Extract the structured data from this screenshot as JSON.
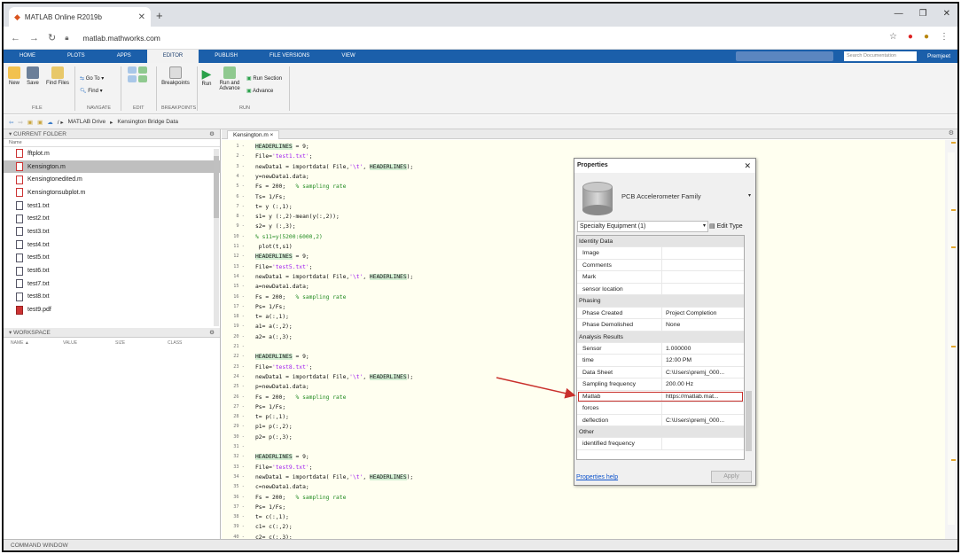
{
  "browser": {
    "tab_title": "MATLAB Online R2019b",
    "url": "matlab.mathworks.com"
  },
  "toolstrip": {
    "tabs": [
      "HOME",
      "PLOTS",
      "APPS",
      "EDITOR",
      "PUBLISH",
      "FILE VERSIONS",
      "VIEW"
    ],
    "active_tab": "EDITOR",
    "search_placeholder": "Search Documentation",
    "user": "Premjeet"
  },
  "ribbon": {
    "new": "New",
    "save": "Save",
    "find_files": "Find Files",
    "go_to": "Go To",
    "find": "Find",
    "breakpoints": "Breakpoints",
    "run": "Run",
    "run_and_advance": "Run and Advance",
    "run_section": "Run Section",
    "advance": "Advance",
    "groups": [
      "FILE",
      "NAVIGATE",
      "EDIT",
      "BREAKPOINTS",
      "RUN"
    ]
  },
  "pathbar": {
    "crumbs": [
      "MATLAB Drive",
      "Kensington Bridge Data"
    ]
  },
  "current_folder": {
    "title": "CURRENT FOLDER",
    "col_name": "Name",
    "files": [
      {
        "name": "fftplot.m",
        "type": "m",
        "selected": false
      },
      {
        "name": "Kensington.m",
        "type": "m",
        "selected": true
      },
      {
        "name": "Kensingtonedited.m",
        "type": "m",
        "selected": false
      },
      {
        "name": "Kensingtonsubplot.m",
        "type": "m",
        "selected": false
      },
      {
        "name": "test1.txt",
        "type": "txt",
        "selected": false
      },
      {
        "name": "test2.txt",
        "type": "txt",
        "selected": false
      },
      {
        "name": "test3.txt",
        "type": "txt",
        "selected": false
      },
      {
        "name": "test4.txt",
        "type": "txt",
        "selected": false
      },
      {
        "name": "test5.txt",
        "type": "txt",
        "selected": false
      },
      {
        "name": "test6.txt",
        "type": "txt",
        "selected": false
      },
      {
        "name": "test7.txt",
        "type": "txt",
        "selected": false
      },
      {
        "name": "test8.txt",
        "type": "txt",
        "selected": false
      },
      {
        "name": "test9.pdf",
        "type": "pdf",
        "selected": false
      }
    ]
  },
  "workspace": {
    "title": "WORKSPACE",
    "columns": [
      "NAME ▲",
      "VALUE",
      "SIZE",
      "CLASS"
    ]
  },
  "editor": {
    "tab": "Kensington.m ×",
    "lines": [
      [
        {
          "t": "HEADERLINES",
          "c": "hl"
        },
        {
          "t": " = 9;"
        }
      ],
      [
        {
          "t": "File="
        },
        {
          "t": "'test1.txt'",
          "c": "str"
        },
        {
          "t": ";"
        }
      ],
      [
        {
          "t": "newData1 = importdata( File,"
        },
        {
          "t": "'\\t'",
          "c": "str"
        },
        {
          "t": ", "
        },
        {
          "t": "HEADERLINES",
          "c": "hl"
        },
        {
          "t": ");"
        }
      ],
      [
        {
          "t": "y=newData1.data;"
        }
      ],
      [
        {
          "t": "Fs = 200;   "
        },
        {
          "t": "% sampling rate",
          "c": "cmt"
        }
      ],
      [
        {
          "t": "Ts= 1/Fs;"
        }
      ],
      [
        {
          "t": "t= y (:,1);"
        }
      ],
      [
        {
          "t": "s1= y (:,2)-mean(y(:,2));"
        }
      ],
      [
        {
          "t": "s2= y (:,3);"
        }
      ],
      [
        {
          "t": "% s11=y(5200:6000,2)",
          "c": "cmt"
        }
      ],
      [
        {
          "t": " plot(t,s1)"
        }
      ],
      [
        {
          "t": "HEADERLINES",
          "c": "hl"
        },
        {
          "t": " = 9;"
        }
      ],
      [
        {
          "t": "File="
        },
        {
          "t": "'test5.txt'",
          "c": "str"
        },
        {
          "t": ";"
        }
      ],
      [
        {
          "t": "newData1 = importdata( File,"
        },
        {
          "t": "'\\t'",
          "c": "str"
        },
        {
          "t": ", "
        },
        {
          "t": "HEADERLINES",
          "c": "hl"
        },
        {
          "t": ");"
        }
      ],
      [
        {
          "t": "a=newData1.data;"
        }
      ],
      [
        {
          "t": "Fs = 200;   "
        },
        {
          "t": "% sampling rate",
          "c": "cmt"
        }
      ],
      [
        {
          "t": "Ps= 1/Fs;"
        }
      ],
      [
        {
          "t": "t= a(:,1);"
        }
      ],
      [
        {
          "t": "a1= a(:,2);"
        }
      ],
      [
        {
          "t": "a2= a(:,3);"
        }
      ],
      [],
      [
        {
          "t": "HEADERLINES",
          "c": "hl"
        },
        {
          "t": " = 9;"
        }
      ],
      [
        {
          "t": "File="
        },
        {
          "t": "'test8.txt'",
          "c": "str"
        },
        {
          "t": ";"
        }
      ],
      [
        {
          "t": "newData1 = importdata( File,"
        },
        {
          "t": "'\\t'",
          "c": "str"
        },
        {
          "t": ", "
        },
        {
          "t": "HEADERLINES",
          "c": "hl"
        },
        {
          "t": ");"
        }
      ],
      [
        {
          "t": "p=newData1.data;"
        }
      ],
      [
        {
          "t": "Fs = 200;   "
        },
        {
          "t": "% sampling rate",
          "c": "cmt"
        }
      ],
      [
        {
          "t": "Ps= 1/Fs;"
        }
      ],
      [
        {
          "t": "t= p(:,1);"
        }
      ],
      [
        {
          "t": "p1= p(:,2);"
        }
      ],
      [
        {
          "t": "p2= p(:,3);"
        }
      ],
      [],
      [
        {
          "t": "HEADERLINES",
          "c": "hl"
        },
        {
          "t": " = 9;"
        }
      ],
      [
        {
          "t": "File="
        },
        {
          "t": "'test9.txt'",
          "c": "str"
        },
        {
          "t": ";"
        }
      ],
      [
        {
          "t": "newData1 = importdata( File,"
        },
        {
          "t": "'\\t'",
          "c": "str"
        },
        {
          "t": ", "
        },
        {
          "t": "HEADERLINES",
          "c": "hl"
        },
        {
          "t": ");"
        }
      ],
      [
        {
          "t": "c=newData1.data;"
        }
      ],
      [
        {
          "t": "Fs = 200;   "
        },
        {
          "t": "% sampling rate",
          "c": "cmt"
        }
      ],
      [
        {
          "t": "Ps= 1/Fs;"
        }
      ],
      [
        {
          "t": "t= c(:,1);"
        }
      ],
      [
        {
          "t": "c1= c(:,2);"
        }
      ],
      [
        {
          "t": "c2= c(:,3);"
        }
      ]
    ]
  },
  "command_window": "COMMAND WINDOW",
  "properties": {
    "title": "Properties",
    "family": "PCB Accelerometer Family",
    "category": "Specialty Equipment (1)",
    "edit_type": "Edit Type",
    "rows": [
      {
        "cat": "Identity Data"
      },
      {
        "k": "Image",
        "v": ""
      },
      {
        "k": "Comments",
        "v": ""
      },
      {
        "k": "Mark",
        "v": ""
      },
      {
        "k": "sensor location",
        "v": ""
      },
      {
        "cat": "Phasing"
      },
      {
        "k": "Phase Created",
        "v": "Project Completion"
      },
      {
        "k": "Phase Demolished",
        "v": "None"
      },
      {
        "cat": "Analysis Results"
      },
      {
        "k": "Sensor",
        "v": "1.000000"
      },
      {
        "k": "time",
        "v": "12:00 PM"
      },
      {
        "k": "Data Sheet",
        "v": "C:\\Users\\premj_000..."
      },
      {
        "k": "Sampling frequency",
        "v": "200.00 Hz"
      },
      {
        "k": "Matlab",
        "v": "https://matlab.mat...",
        "red": true
      },
      {
        "k": "forces",
        "v": ""
      },
      {
        "k": "deflection",
        "v": "C:\\Users\\premj_000..."
      },
      {
        "cat": "Other"
      },
      {
        "k": "identified frequency",
        "v": ""
      }
    ],
    "help_link": "Properties help",
    "apply": "Apply"
  },
  "colors": {
    "toolstrip_blue": "#1b5faa",
    "editor_bg": "#fffff0",
    "highlight": "#d4efd4",
    "string": "#a020f0",
    "comment": "#228b22",
    "annotation_red": "#c9302c"
  }
}
